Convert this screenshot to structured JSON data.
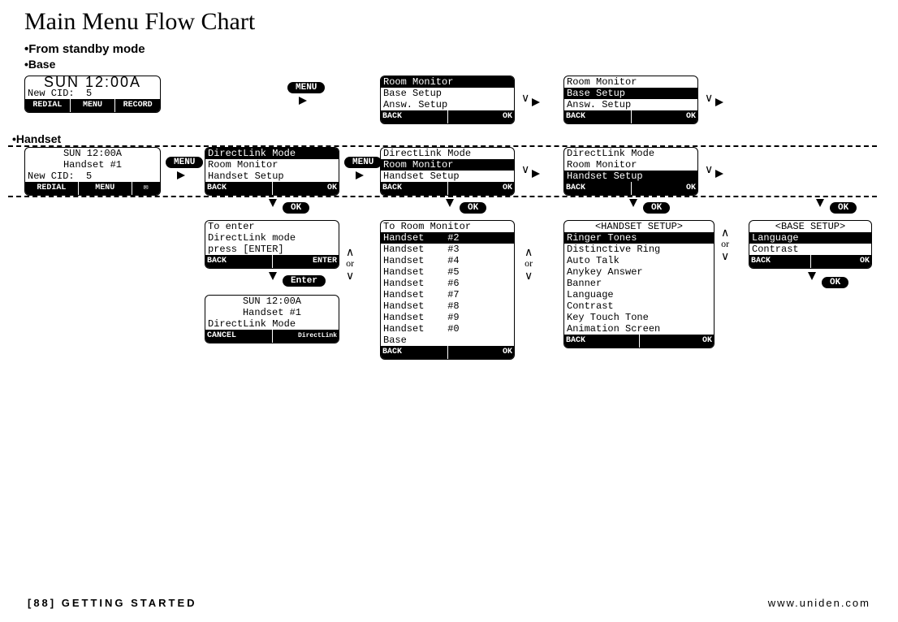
{
  "title": "Main Menu Flow Chart",
  "bullets": {
    "standby": "From standby mode",
    "base": "Base",
    "handset": "Handset"
  },
  "labels": {
    "menu": "MENU",
    "ok": "OK",
    "enter": "Enter",
    "or": "or",
    "chev_up": "∧",
    "chev_down": "∨"
  },
  "base_standby": {
    "clock": "SUN 12:00A",
    "line2": "New CID:  5",
    "softkeys": [
      "REDIAL",
      "MENU",
      "RECORD"
    ]
  },
  "base_menu1": {
    "l1": "Room Monitor",
    "l2": "Base Setup",
    "l3": "Answ. Setup",
    "softkeys": [
      "BACK",
      "OK"
    ]
  },
  "base_menu2": {
    "l1": "Room Monitor",
    "l2": "Base Setup",
    "l3": "Answ. Setup",
    "softkeys": [
      "BACK",
      "OK"
    ]
  },
  "hs_standby": {
    "clock": "SUN 12:00A",
    "line2": "Handset #1",
    "line3": "New CID:  5",
    "softkeys": [
      "REDIAL",
      "MENU"
    ]
  },
  "hs_menu1": {
    "l1": "DirectLink Mode",
    "l2": "Room Monitor",
    "l3": "Handset Setup",
    "softkeys": [
      "BACK",
      "OK"
    ]
  },
  "hs_menu2": {
    "l1": "DirectLink Mode",
    "l2": "Room Monitor",
    "l3": "Handset Setup",
    "softkeys": [
      "BACK",
      "OK"
    ]
  },
  "hs_menu3": {
    "l1": "DirectLink Mode",
    "l2": "Room Monitor",
    "l3": "Handset Setup",
    "softkeys": [
      "BACK",
      "OK"
    ]
  },
  "dl_enter": {
    "l1": "To enter",
    "l2": "DirectLink mode",
    "l3": "press [ENTER]",
    "softkeys": [
      "BACK",
      "ENTER"
    ]
  },
  "dl_mode": {
    "l1": "SUN 12:00A",
    "l2": "Handset #1",
    "l3": "DirectLink Mode",
    "softkeys": [
      "CANCEL",
      "DirectLink"
    ]
  },
  "room_mon": {
    "title": "To Room Monitor",
    "rows": [
      "Handset    #2",
      "Handset    #3",
      "Handset    #4",
      "Handset    #5",
      "Handset    #6",
      "Handset    #7",
      "Handset    #8",
      "Handset    #9",
      "Handset    #0",
      "Base"
    ],
    "softkeys": [
      "BACK",
      "OK"
    ]
  },
  "hs_setup": {
    "title": "<HANDSET SETUP>",
    "rows": [
      "Ringer Tones",
      "Distinctive Ring",
      "Auto Talk",
      "Anykey Answer",
      "Banner",
      "Language",
      "Contrast",
      "Key Touch Tone",
      "Animation Screen"
    ],
    "softkeys": [
      "BACK",
      "OK"
    ]
  },
  "base_setup": {
    "title": "<BASE SETUP>",
    "rows": [
      "Language",
      "Contrast"
    ],
    "softkeys": [
      "BACK",
      "OK"
    ]
  },
  "footer": {
    "left": "[88] GETTING STARTED",
    "right": "www.uniden.com"
  }
}
